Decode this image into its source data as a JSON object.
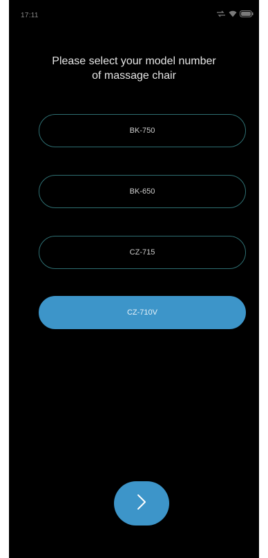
{
  "status_bar": {
    "time": "17:11",
    "icons": [
      "signal-icon",
      "wifi-icon",
      "battery-icon"
    ]
  },
  "title": "Please select your model number\nof massage chair",
  "models": [
    {
      "label": "BK-750",
      "selected": false
    },
    {
      "label": "BK-650",
      "selected": false
    },
    {
      "label": "CZ-715",
      "selected": false
    },
    {
      "label": "CZ-710V",
      "selected": true
    }
  ],
  "next_button": {
    "icon": "chevron-right-icon"
  },
  "colors": {
    "background": "#000000",
    "accent": "#3d95c9",
    "outline": "#2e6f72"
  }
}
